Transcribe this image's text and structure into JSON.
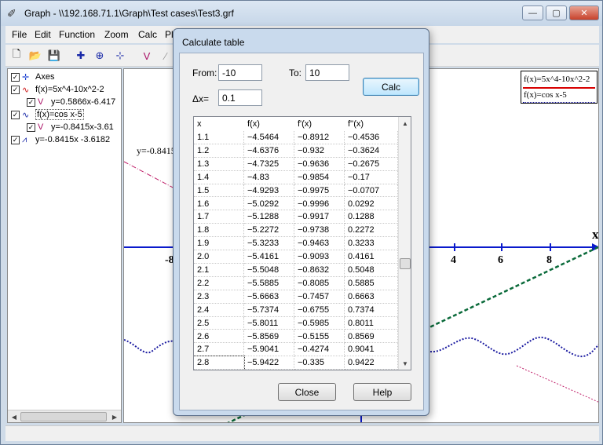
{
  "window": {
    "title": "Graph - \\\\192.168.71.1\\Graph\\Test cases\\Test3.grf",
    "minimize_glyph": "—",
    "maximize_glyph": "▢",
    "close_glyph": "✕"
  },
  "menu": [
    "File",
    "Edit",
    "Function",
    "Zoom",
    "Calc",
    "Pl"
  ],
  "toolbar_icons": [
    {
      "name": "new-file-icon",
      "glyph": "🗋"
    },
    {
      "name": "open-folder-icon",
      "glyph": "📂"
    },
    {
      "name": "save-icon",
      "glyph": "💾"
    },
    {
      "name": "insert-function-icon",
      "glyph": "✚"
    },
    {
      "name": "insert-tangent-icon",
      "glyph": "⊕"
    },
    {
      "name": "insert-point-series-icon",
      "glyph": "⊹"
    },
    {
      "name": "insert-shading-icon",
      "glyph": "V"
    },
    {
      "name": "insert-relation-icon",
      "glyph": "⁄"
    }
  ],
  "tree": [
    {
      "level": 0,
      "label": "Axes",
      "icon": "✛",
      "color": "#1a3fd0",
      "checked": true
    },
    {
      "level": 0,
      "label": "f(x)=5x^4-10x^2-2",
      "icon": "∿",
      "color": "#cc1111",
      "checked": true
    },
    {
      "level": 1,
      "label": "y=0.5866x-6.417",
      "icon": "V",
      "color": "#aa1166",
      "checked": true
    },
    {
      "level": 0,
      "label": "f(x)=cos x-5",
      "icon": "∿",
      "color": "#1a2aa8",
      "checked": true
    },
    {
      "level": 1,
      "label": "y=-0.8415x-3.61",
      "icon": "V",
      "color": "#aa1166",
      "checked": true
    },
    {
      "level": 0,
      "label": "y=-0.8415x -3.6182",
      "icon": "⩘",
      "color": "#1a2aa8",
      "checked": true
    }
  ],
  "graph": {
    "x_axis_label": "x",
    "tick_labels": [
      "-8",
      "4",
      "6",
      "8"
    ],
    "annotation": "y=-0.8415",
    "legend": [
      "f(x)=5x^4-10x^2-2",
      "f(x)=cos x-5"
    ],
    "colors": {
      "axis": "#0a1acc",
      "f1": "#d80000",
      "f2": "#1a1aa0",
      "tangent": "#c0206a",
      "line": "#0a6a3a"
    }
  },
  "dialog": {
    "title": "Calculate table",
    "from_label": "From:",
    "from_value": "-10",
    "to_label": "To:",
    "to_value": "10",
    "dx_label": "Δx=",
    "dx_value": "0.1",
    "calc_button": "Calc",
    "close_button": "Close",
    "help_button": "Help"
  },
  "table": {
    "headers": [
      "x",
      "f(x)",
      "f'(x)",
      "f''(x)"
    ],
    "rows": [
      [
        "1.1",
        "−4.5464",
        "−0.8912",
        "−0.4536"
      ],
      [
        "1.2",
        "−4.6376",
        "−0.932",
        "−0.3624"
      ],
      [
        "1.3",
        "−4.7325",
        "−0.9636",
        "−0.2675"
      ],
      [
        "1.4",
        "−4.83",
        "−0.9854",
        "−0.17"
      ],
      [
        "1.5",
        "−4.9293",
        "−0.9975",
        "−0.0707"
      ],
      [
        "1.6",
        "−5.0292",
        "−0.9996",
        "0.0292"
      ],
      [
        "1.7",
        "−5.1288",
        "−0.9917",
        "0.1288"
      ],
      [
        "1.8",
        "−5.2272",
        "−0.9738",
        "0.2272"
      ],
      [
        "1.9",
        "−5.3233",
        "−0.9463",
        "0.3233"
      ],
      [
        "2.0",
        "−5.4161",
        "−0.9093",
        "0.4161"
      ],
      [
        "2.1",
        "−5.5048",
        "−0.8632",
        "0.5048"
      ],
      [
        "2.2",
        "−5.5885",
        "−0.8085",
        "0.5885"
      ],
      [
        "2.3",
        "−5.6663",
        "−0.7457",
        "0.6663"
      ],
      [
        "2.4",
        "−5.7374",
        "−0.6755",
        "0.7374"
      ],
      [
        "2.5",
        "−5.8011",
        "−0.5985",
        "0.8011"
      ],
      [
        "2.6",
        "−5.8569",
        "−0.5155",
        "0.8569"
      ],
      [
        "2.7",
        "−5.9041",
        "−0.4274",
        "0.9041"
      ],
      [
        "2.8",
        "−5.9422",
        "−0.335",
        "0.9422"
      ]
    ]
  }
}
